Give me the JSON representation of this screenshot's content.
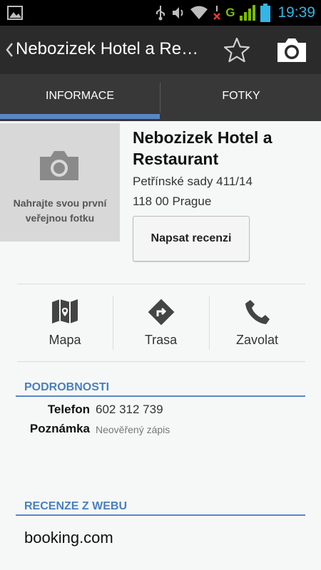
{
  "status_bar": {
    "time": "19:39",
    "network_label": "G",
    "accent_color": "#33b5e5",
    "icons": [
      "gallery-icon",
      "usb-icon",
      "volume-icon",
      "wifi-icon",
      "no-signal-icon",
      "signal-icon",
      "battery-icon"
    ]
  },
  "action_bar": {
    "title": "Nebozizek Hotel a Re…",
    "icons": [
      "back-chevron-icon",
      "star-icon",
      "camera-icon"
    ]
  },
  "tabs": [
    {
      "label": "INFORMACE",
      "selected": true
    },
    {
      "label": "FOTKY",
      "selected": false
    }
  ],
  "place": {
    "photo_prompt": "Nahrajte svou první veřejnou fotku",
    "name": "Nebozizek Hotel a Restaurant",
    "address_line1": "Petřínské sady 411/14",
    "address_line2": "118 00 Prague",
    "write_review_label": "Napsat recenzi"
  },
  "actions": [
    {
      "label": "Mapa",
      "icon": "map-icon"
    },
    {
      "label": "Trasa",
      "icon": "directions-icon"
    },
    {
      "label": "Zavolat",
      "icon": "phone-icon"
    }
  ],
  "details": {
    "heading": "PODROBNOSTI",
    "rows": [
      {
        "label": "Telefon",
        "value": "602 312 739"
      },
      {
        "label": "Poznámka",
        "value": "Neověřený zápis"
      }
    ]
  },
  "web_reviews": {
    "heading": "RECENZE Z WEBU",
    "sources": [
      "booking.com"
    ]
  },
  "colors": {
    "accent_blue": "#5b86c6",
    "heading_blue": "#4a7ec0",
    "action_bar": "#2b2b2b",
    "tab_bar": "#383838"
  }
}
